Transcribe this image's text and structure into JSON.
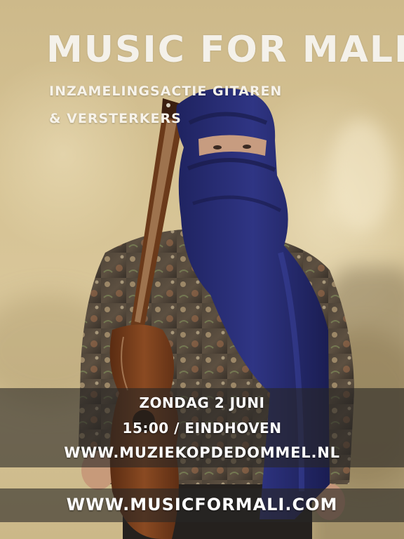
{
  "title": "MUSIC FOR MALI",
  "subtitle_lines": [
    "INZAMELINGSACTIE GITAREN",
    "& VERSTERKERS"
  ],
  "event": {
    "date": "ZONDAG 2 JUNI",
    "time_location": "15:00 / EINDHOVEN",
    "website": "WWW.MUZIEKOPDEDOMMEL.NL"
  },
  "footer_website": "WWW.MUSICFORMALI.COM",
  "colors": {
    "wall": "#d6c394",
    "text": "#f4f1ea",
    "band": "#28262499",
    "turban": "#2a2f78",
    "guitar": "#7a3f1c"
  }
}
